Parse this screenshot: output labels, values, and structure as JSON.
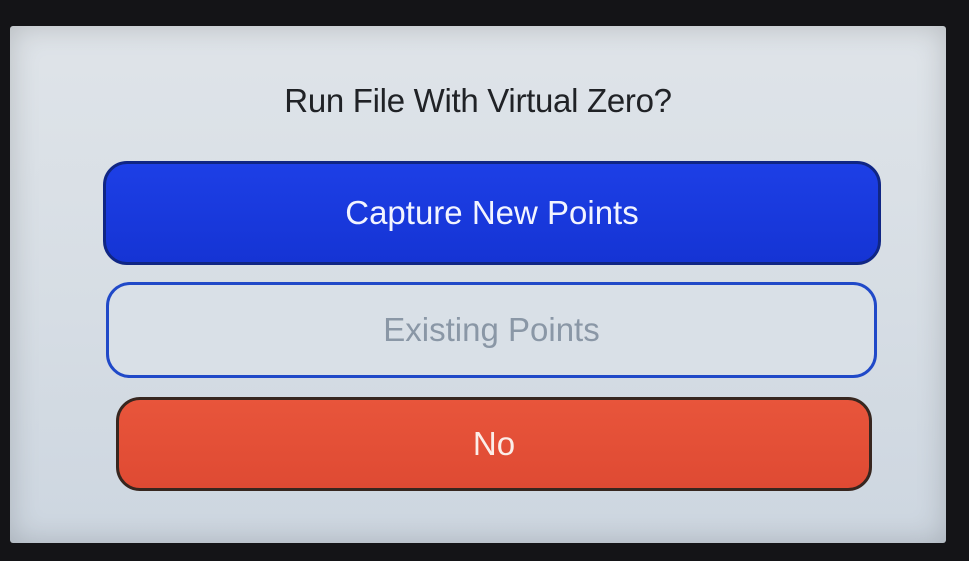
{
  "dialog": {
    "title": "Run File With Virtual Zero?",
    "buttons": {
      "capture_new": {
        "label": "Capture New Points",
        "color": "#1a3ae0",
        "state": "enabled"
      },
      "existing": {
        "label": "Existing Points",
        "color": "#d9e0e7",
        "state": "disabled"
      },
      "no": {
        "label": "No",
        "color": "#e4503a",
        "state": "enabled"
      }
    }
  }
}
